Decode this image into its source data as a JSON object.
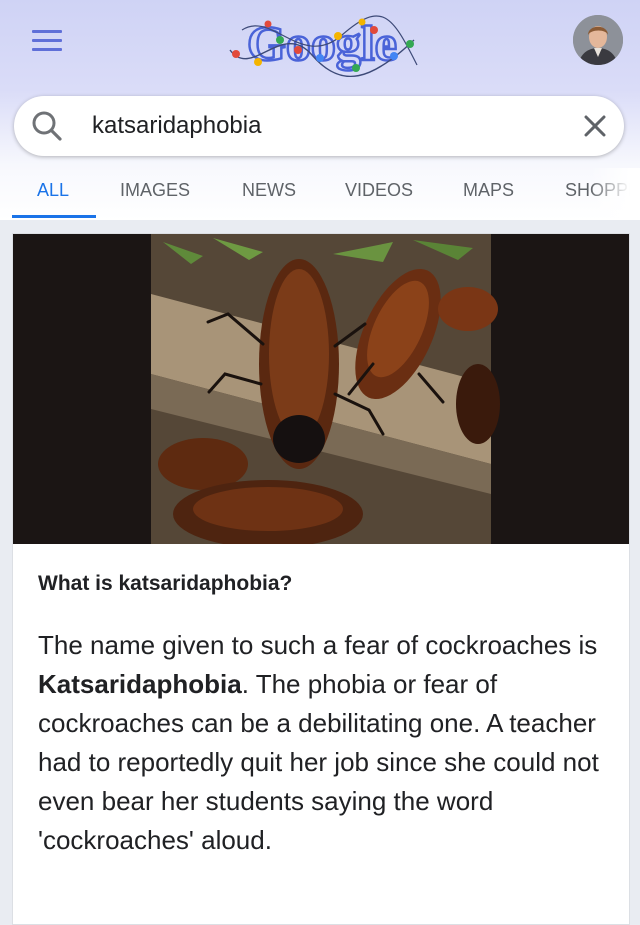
{
  "header": {
    "logo_text": "Google",
    "menu_icon": "hamburger-menu-icon",
    "avatar_icon": "profile-avatar"
  },
  "search": {
    "query": "katsaridaphobia",
    "search_icon": "search-icon",
    "clear_icon": "close-icon"
  },
  "tabs": [
    {
      "label": "ALL",
      "active": true
    },
    {
      "label": "IMAGES",
      "active": false
    },
    {
      "label": "NEWS",
      "active": false
    },
    {
      "label": "VIDEOS",
      "active": false
    },
    {
      "label": "MAPS",
      "active": false
    },
    {
      "label": "SHOPPI",
      "active": false
    }
  ],
  "snippet": {
    "image_subject": "hissing cockroaches on a log",
    "question": "What is katsaridaphobia?",
    "answer_pre": "The name given to such a fear of cockroaches is ",
    "answer_bold": "Katsaridaphobia",
    "answer_post": ". The phobia or fear of cockroaches can be a debilitating one. A teacher had to reportedly quit her job since she could not even bear her students saying the word 'cockroaches' aloud."
  },
  "colors": {
    "accent": "#1a73e8",
    "header_bg": "#cfd3f5",
    "menu_icon": "#5f6fd8",
    "tab_inactive": "#5f6368",
    "text": "#202124"
  }
}
